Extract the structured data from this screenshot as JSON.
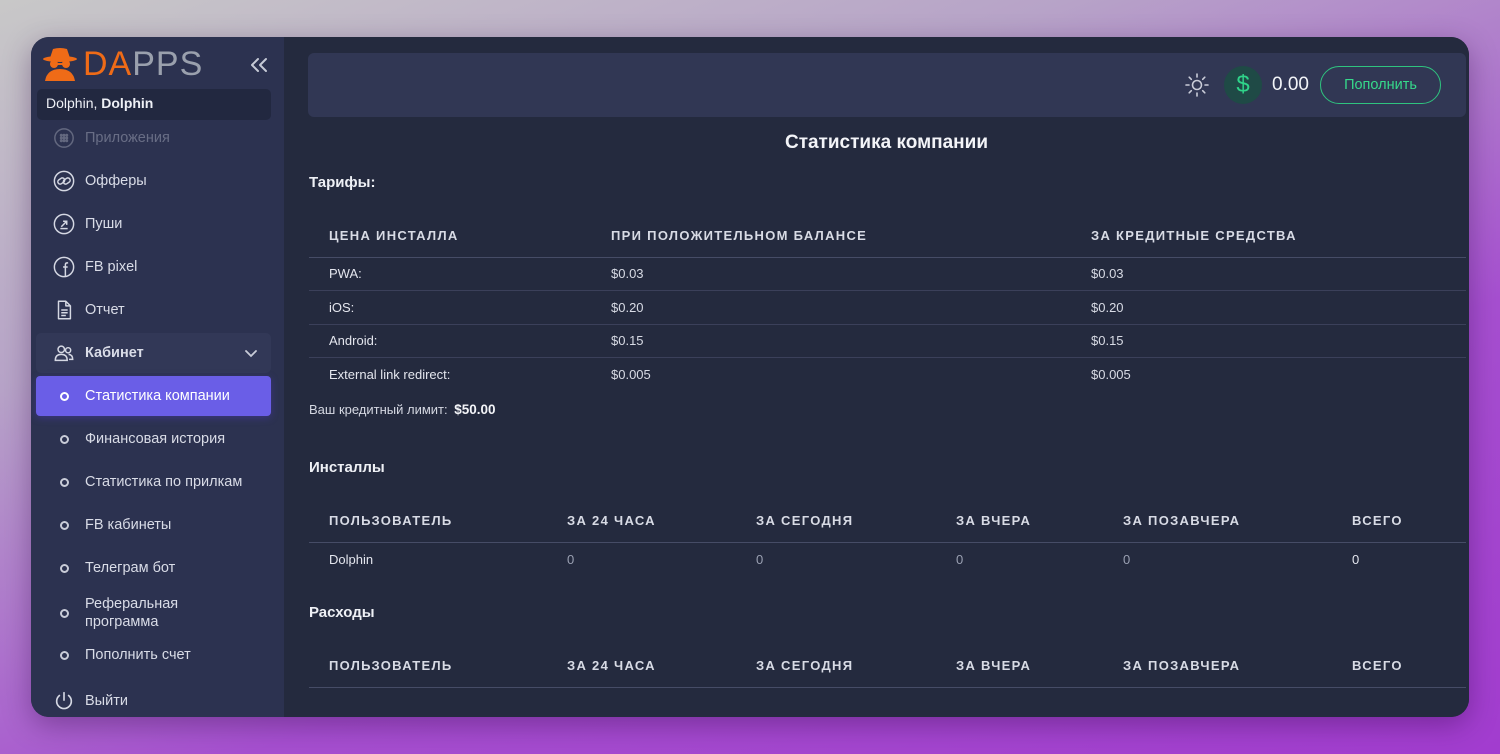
{
  "sidebar": {
    "logo_da": "DA",
    "logo_pps": "PPS",
    "user_name": "Dolphin,",
    "user_company": "Dolphin",
    "nav": {
      "apps": "Приложения",
      "offers": "Офферы",
      "pushes": "Пуши",
      "fb_pixel": "FB pixel",
      "report": "Отчет",
      "cabinet": "Кабинет"
    },
    "sub": {
      "company_stats": "Статистика компании",
      "finance_history": "Финансовая история",
      "apps_stats": "Статистика по прилкам",
      "fb_cabinets": "FB кабинеты",
      "telegram_bot": "Телеграм бот",
      "referral": "Реферальная программа",
      "topup": "Пополнить счет"
    },
    "logout": "Выйти"
  },
  "topbar": {
    "balance": "0.00",
    "currency_icon": "$",
    "topup_label": "Пополнить"
  },
  "main": {
    "page_title": "Статистика компании",
    "tariffs_title": "Тарифы:",
    "tariffs": {
      "headers": [
        "Цена инсталла",
        "При положительном балансе",
        "За кредитные средства"
      ],
      "rows": [
        [
          "PWA:",
          "$0.03",
          "$0.03"
        ],
        [
          "iOS:",
          "$0.20",
          "$0.20"
        ],
        [
          "Android:",
          "$0.15",
          "$0.15"
        ],
        [
          "External link redirect:",
          "$0.005",
          "$0.005"
        ]
      ]
    },
    "credit_label": "Ваш кредитный лимит:",
    "credit_value": "$50.00",
    "installs_title": "Инсталлы",
    "installs": {
      "headers": [
        "Пользователь",
        "За 24 часа",
        "За сегодня",
        "За вчера",
        "За позавчера",
        "Всего"
      ],
      "rows": [
        [
          "Dolphin",
          "0",
          "0",
          "0",
          "0",
          "0"
        ]
      ]
    },
    "expenses_title": "Расходы",
    "expenses": {
      "headers": [
        "Пользователь",
        "За 24 часа",
        "За сегодня",
        "За вчера",
        "За позавчера",
        "Всего"
      ]
    }
  },
  "colors": {
    "accent": "#6a5ee7",
    "success": "#2fc37f",
    "brand": "#ef6b17"
  }
}
